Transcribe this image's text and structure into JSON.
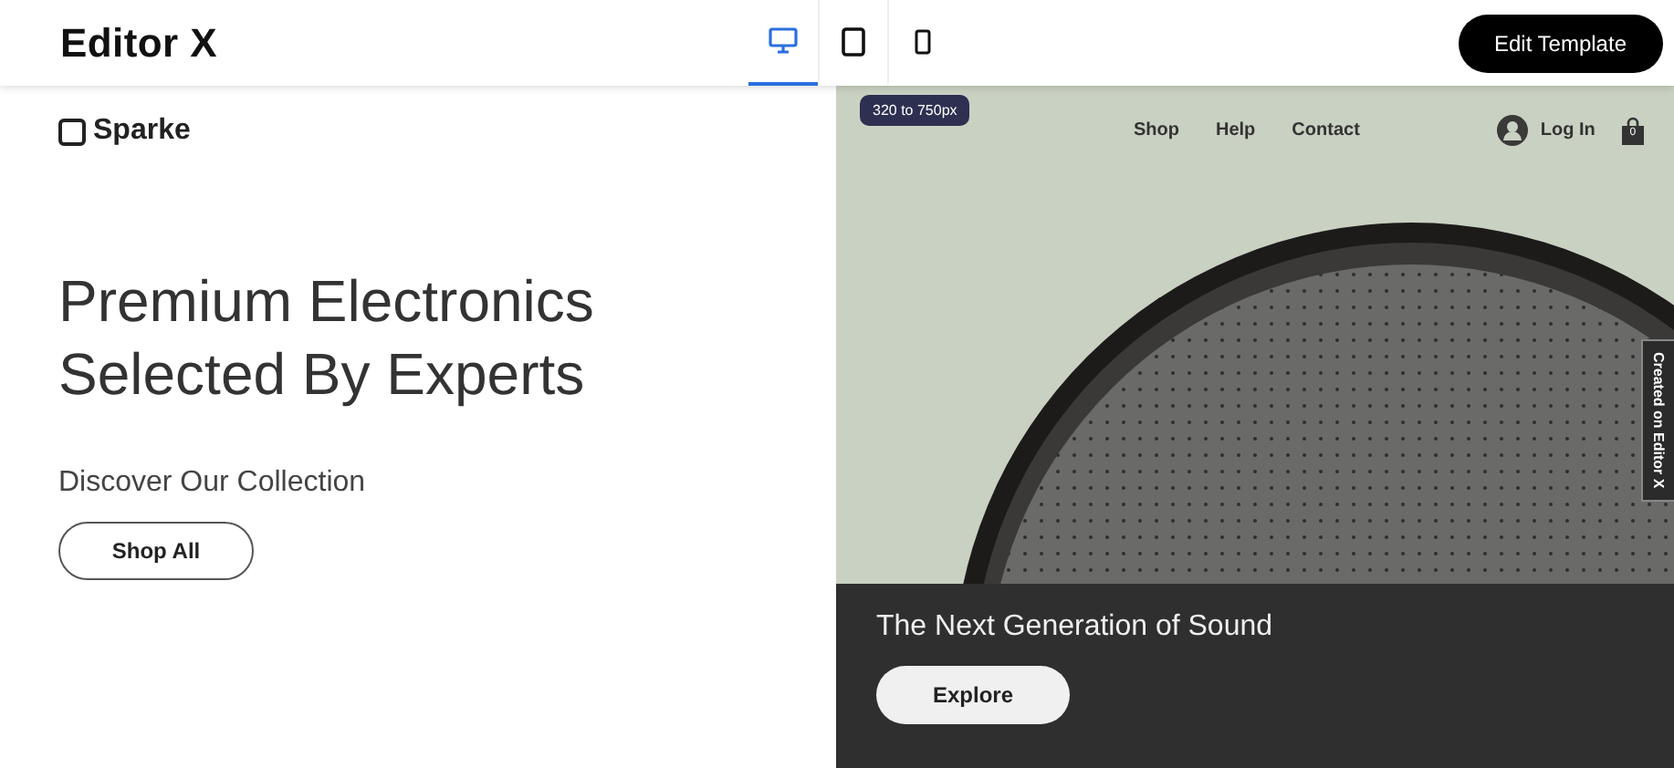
{
  "editor": {
    "logo": "Editor X",
    "devices": [
      {
        "kind": "desktop",
        "selected": true
      },
      {
        "kind": "tablet",
        "selected": false
      },
      {
        "kind": "mobile",
        "selected": false
      }
    ],
    "action_button": "Edit Template"
  },
  "site": {
    "brand": "Sparke",
    "headline": "Premium Electronics\nSelected By Experts",
    "subtitle": "Discover Our Collection",
    "button": "Shop All"
  },
  "preview": {
    "badge": "320 to 750px",
    "nav": [
      "Shop",
      "Help",
      "Contact"
    ],
    "login": "Log In",
    "cart_count": "0",
    "side_tab": "Created on Editor X",
    "caption": "The Next Generation of Sound",
    "button": "Explore"
  }
}
